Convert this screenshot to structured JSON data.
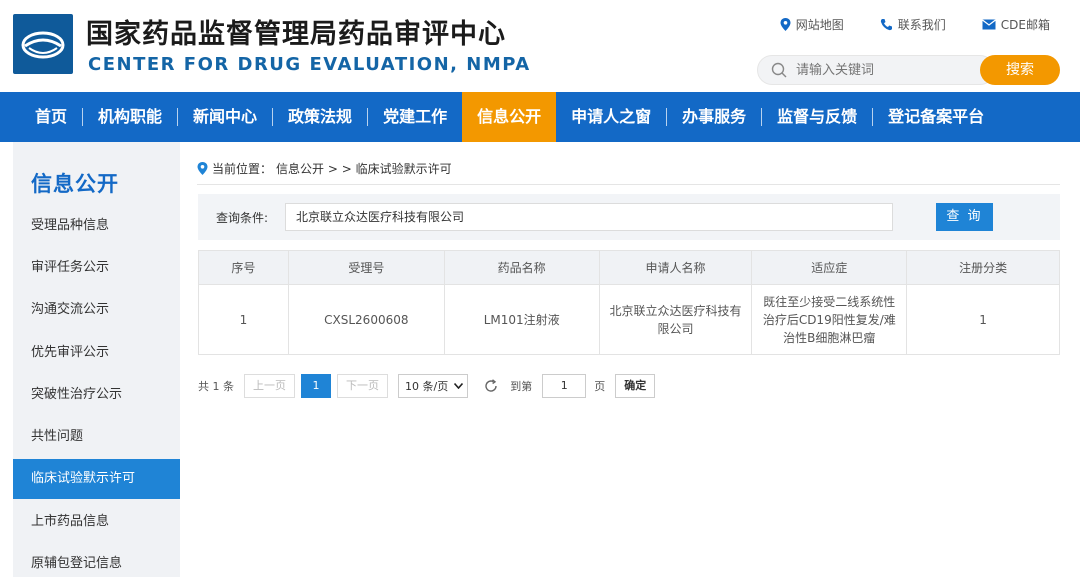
{
  "header": {
    "title_cn": "国家药品监督管理局药品审评中心",
    "title_en": "CENTER FOR DRUG EVALUATION, NMPA",
    "links": [
      "网站地图",
      "联系我们",
      "CDE邮箱"
    ],
    "search_placeholder": "请输入关键词",
    "search_button": "搜索"
  },
  "nav": {
    "items": [
      "首页",
      "机构职能",
      "新闻中心",
      "政策法规",
      "党建工作",
      "信息公开",
      "申请人之窗",
      "办事服务",
      "监督与反馈",
      "登记备案平台"
    ],
    "active": "信息公开"
  },
  "sidebar": {
    "title": "信息公开",
    "items": [
      "受理品种信息",
      "审评任务公示",
      "沟通交流公示",
      "优先审评公示",
      "突破性治疗公示",
      "共性问题",
      "临床试验默示许可",
      "上市药品信息",
      "原辅包登记信息"
    ],
    "active": "临床试验默示许可"
  },
  "breadcrumb": {
    "prefix": "当前位置：",
    "path": "信息公开 > > 临床试验默示许可"
  },
  "query": {
    "label": "查询条件:",
    "value": "北京联立众达医疗科技有限公司",
    "button": "查 询"
  },
  "table": {
    "headers": [
      "序号",
      "受理号",
      "药品名称",
      "申请人名称",
      "适应症",
      "注册分类"
    ],
    "rows": [
      [
        "1",
        "CXSL2600608",
        "LM101注射液",
        "北京联立众达医疗科技有限公司",
        "既往至少接受二线系统性治疗后CD19阳性复发/难治性B细胞淋巴瘤",
        "1"
      ]
    ]
  },
  "pager": {
    "total": "共 1 条",
    "prev": "上一页",
    "current": "1",
    "next": "下一页",
    "page_size": "10 条/页",
    "goto_label": "到第",
    "goto_value": "1",
    "page_unit": "页",
    "confirm": "确定"
  },
  "colors": {
    "brand_blue": "#1369c6",
    "accent_orange": "#f39800",
    "light_blue": "#1f84d6"
  }
}
